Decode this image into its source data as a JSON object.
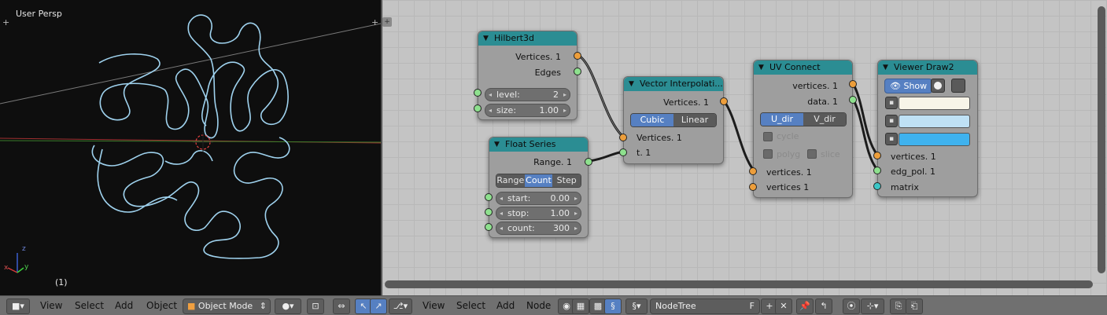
{
  "viewport": {
    "label": "User Persp",
    "frame": "(1)",
    "axis_z": "z",
    "axis_x": "x",
    "axis_y": "y"
  },
  "nodes": {
    "hilbert": {
      "title": "Hilbert3d",
      "out_vertices": "Vertices. 1",
      "out_edges": "Edges",
      "level_label": "level:",
      "level_value": "2",
      "size_label": "size:",
      "size_value": "1.00"
    },
    "float_series": {
      "title": "Float Series",
      "out_range": "Range. 1",
      "modes": [
        "Range",
        "Count",
        "Step"
      ],
      "active_mode": "Count",
      "start_label": "start:",
      "start_value": "0.00",
      "stop_label": "stop:",
      "stop_value": "1.00",
      "count_label": "count:",
      "count_value": "300"
    },
    "vector_interp": {
      "title": "Vector Interpolati...",
      "out_vertices": "Vertices. 1",
      "modes": [
        "Cubic",
        "Linear"
      ],
      "active_mode": "Cubic",
      "in_vertices": "Vertices. 1",
      "in_t": "t. 1"
    },
    "uv_connect": {
      "title": "UV Connect",
      "out_vertices": "vertices. 1",
      "out_data": "data. 1",
      "modes": [
        "U_dir",
        "V_dir"
      ],
      "active_mode": "U_dir",
      "cycle": "cycle",
      "polyg": "polyg",
      "slice": "slice",
      "in_vertices1": "vertices. 1",
      "in_vertices2": "vertices 1"
    },
    "viewer": {
      "title": "Viewer Draw2",
      "show_label": "Show",
      "in_vertices": "vertices. 1",
      "in_edg_pol": "edg_pol. 1",
      "in_matrix": "matrix",
      "color1": "#f7f4e8",
      "color2": "#bfe1f5",
      "color3": "#3fb2ee"
    }
  },
  "colors": {
    "node_header": "#2b8d93",
    "socket_vertices": "#ed9e3b",
    "socket_float": "#8ee08e",
    "socket_matrix": "#3cc6c6",
    "active_button": "#5680c2"
  },
  "header": {
    "left_menu": [
      "View",
      "Select",
      "Add",
      "Object"
    ],
    "mode": "Object Mode",
    "right_menu": [
      "View",
      "Select",
      "Add",
      "Node"
    ],
    "tree_name": "NodeTree",
    "fake_user": "F"
  }
}
